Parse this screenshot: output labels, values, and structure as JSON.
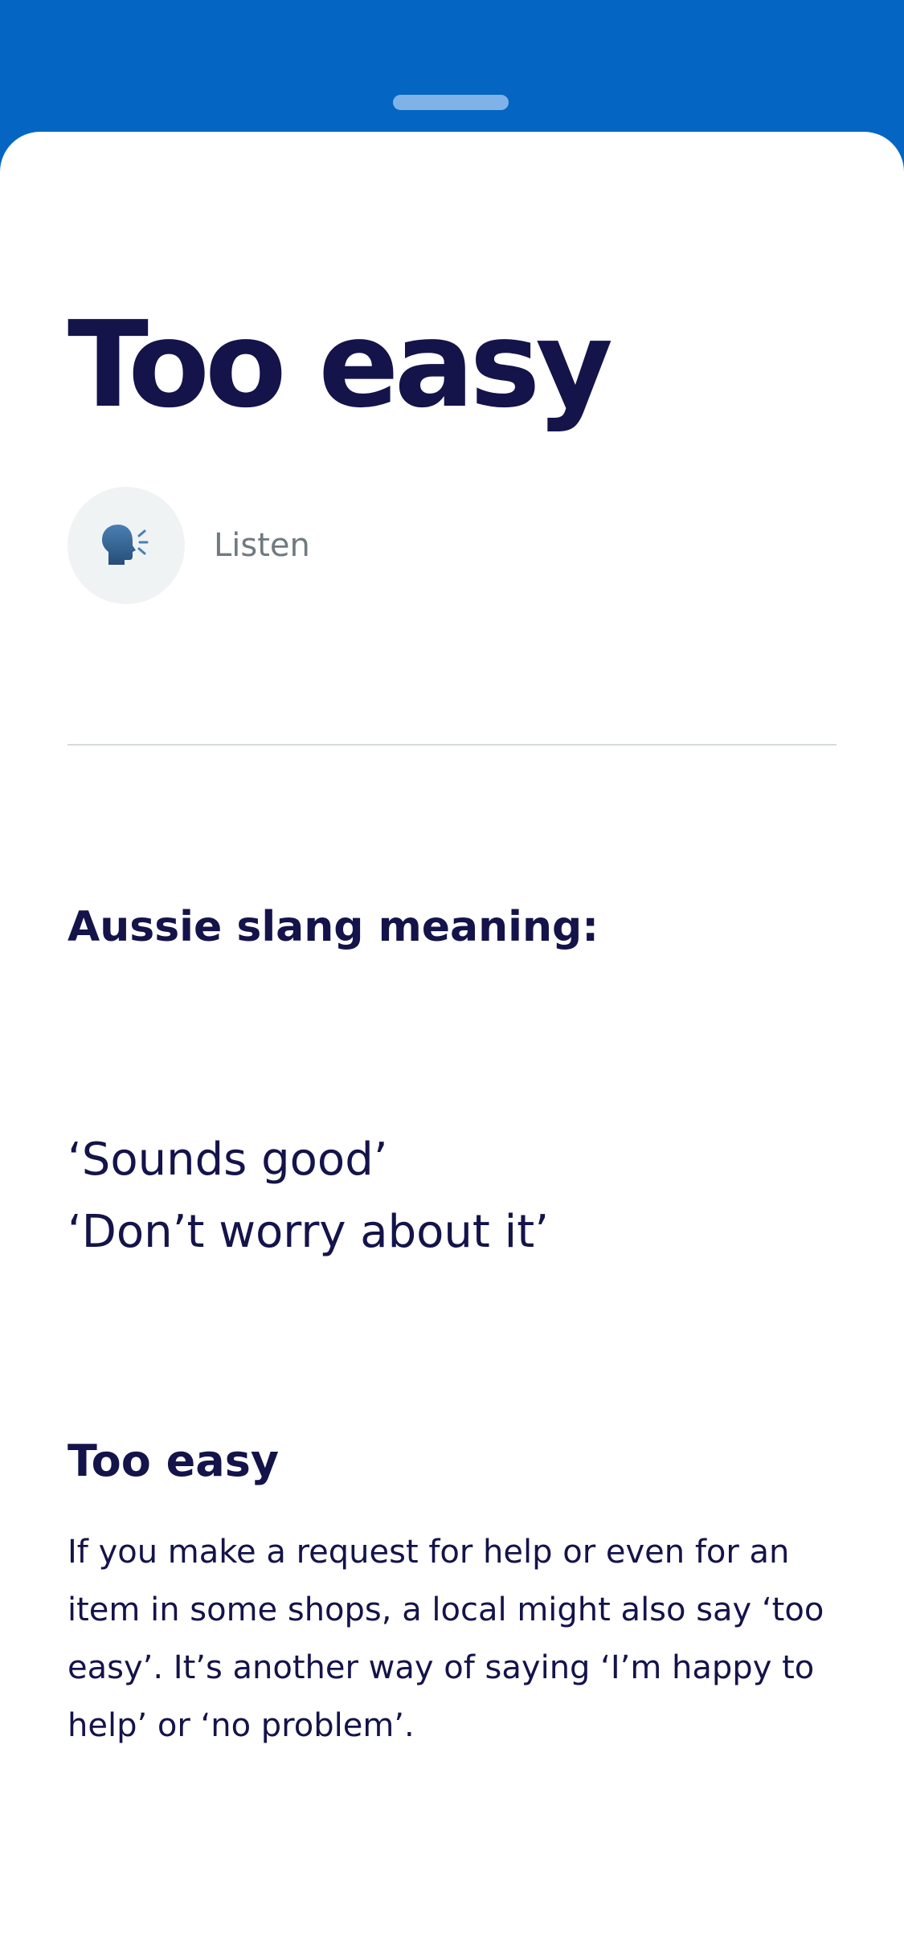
{
  "header": {
    "background_color": "#0466C2"
  },
  "sheet": {
    "title": "Too easy",
    "listen": {
      "label": "Listen",
      "icon": "speaking-head-icon"
    },
    "meaning": {
      "heading": "Aussie slang meaning:",
      "lines": [
        "‘Sounds good’",
        "‘Don’t worry about it’"
      ]
    },
    "section": {
      "heading": "Too easy",
      "body": "If you make a request for help or even for an item in some shops, a local might also say ‘too easy’. It’s another way of saying ‘I’m happy to help’ or ‘no problem’."
    }
  },
  "colors": {
    "brand_blue": "#0466C2",
    "text_navy": "#14134A",
    "muted_grey": "#6F7B80",
    "icon_circle": "#EFF3F4"
  }
}
